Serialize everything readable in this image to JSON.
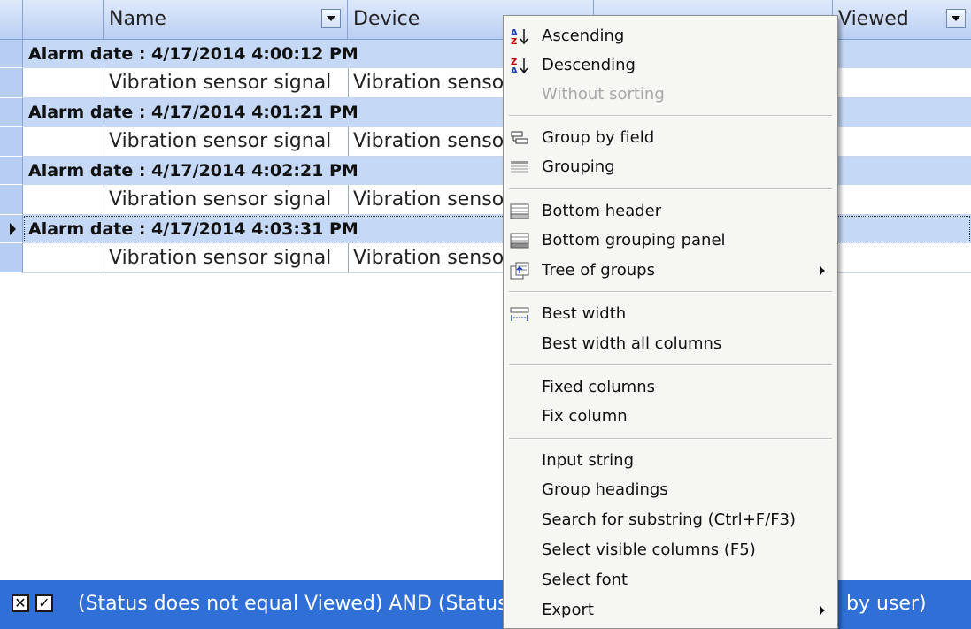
{
  "columns": [
    {
      "label": ""
    },
    {
      "label": "Name"
    },
    {
      "label": "Device"
    },
    {
      "label": ""
    },
    {
      "label": "Viewed"
    }
  ],
  "groups": [
    {
      "header": "Alarm date : 4/17/2014 4:00:12 PM",
      "row": {
        "name": "Vibration sensor signal",
        "device": "Vibration sensor"
      }
    },
    {
      "header": "Alarm date : 4/17/2014 4:01:21 PM",
      "row": {
        "name": "Vibration sensor signal",
        "device": "Vibration sensor"
      }
    },
    {
      "header": "Alarm date : 4/17/2014 4:02:21 PM",
      "row": {
        "name": "Vibration sensor signal",
        "device": "Vibration sensor"
      }
    },
    {
      "header": "Alarm date : 4/17/2014 4:03:31 PM",
      "row": {
        "name": "Vibration sensor signal",
        "device": "Vibration sensor"
      }
    }
  ],
  "filter": {
    "text_left": "(Status does not equal Viewed) AND (Status",
    "text_right": "by user)"
  },
  "menu": {
    "items": [
      {
        "label": "Ascending",
        "icon": "sort-ascending-icon"
      },
      {
        "label": "Descending",
        "icon": "sort-descending-icon"
      },
      {
        "label": "Without sorting",
        "disabled": true
      },
      {
        "label": "Group by field",
        "icon": "group-by-field-icon"
      },
      {
        "label": "Grouping",
        "icon": "grouping-icon"
      },
      {
        "label": "Bottom header",
        "icon": "bottom-header-icon"
      },
      {
        "label": "Bottom grouping panel",
        "icon": "bottom-grouping-panel-icon"
      },
      {
        "label": "Tree of groups",
        "icon": "tree-of-groups-icon",
        "submenu": true
      },
      {
        "label": "Best width",
        "icon": "best-width-icon"
      },
      {
        "label": "Best width all columns"
      },
      {
        "label": "Fixed columns"
      },
      {
        "label": "Fix column"
      },
      {
        "label": "Input string"
      },
      {
        "label": "Group headings"
      },
      {
        "label": "Search for substring (Ctrl+F/F3)"
      },
      {
        "label": "Select visible columns (F5)"
      },
      {
        "label": "Select font"
      },
      {
        "label": "Export",
        "submenu": true
      }
    ]
  },
  "colors": {
    "header": "#c5d9f7",
    "footer": "#2f6fd6",
    "menu_bg": "#f6f6f3"
  }
}
